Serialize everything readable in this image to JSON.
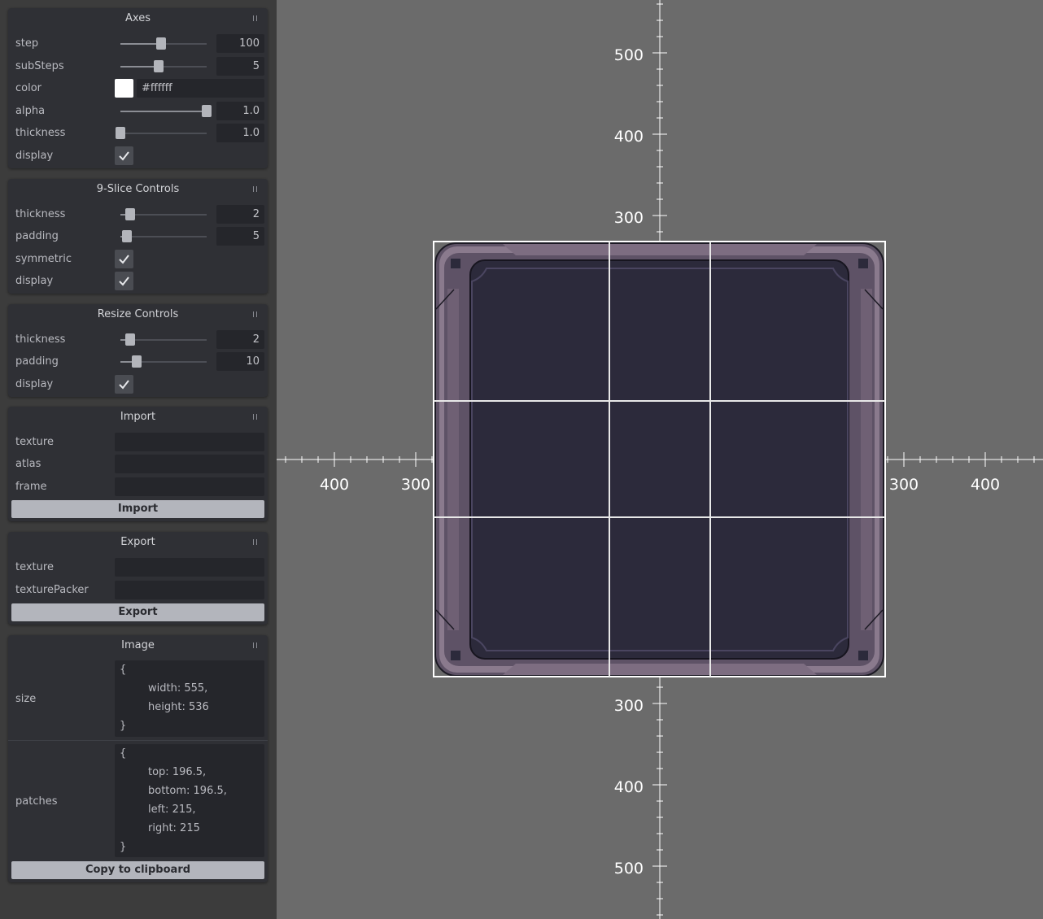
{
  "axes": {
    "title": "Axes",
    "step": {
      "label": "step",
      "value": "100",
      "fraction": 0.47
    },
    "substeps": {
      "label": "subSteps",
      "value": "5",
      "fraction": 0.44
    },
    "color": {
      "label": "color",
      "value": "#ffffff"
    },
    "alpha": {
      "label": "alpha",
      "value": "1.0",
      "fraction": 1.0
    },
    "thickness": {
      "label": "thickness",
      "value": "1.0",
      "fraction": 0.0
    },
    "display": {
      "label": "display",
      "checked": true
    }
  },
  "nine_slice": {
    "title": "9-Slice Controls",
    "thickness": {
      "label": "thickness",
      "value": "2",
      "fraction": 0.11
    },
    "padding": {
      "label": "padding",
      "value": "5",
      "fraction": 0.08
    },
    "symmetric": {
      "label": "symmetric",
      "checked": true
    },
    "display": {
      "label": "display",
      "checked": true
    }
  },
  "resize": {
    "title": "Resize Controls",
    "thickness": {
      "label": "thickness",
      "value": "2",
      "fraction": 0.11
    },
    "padding": {
      "label": "padding",
      "value": "10",
      "fraction": 0.19
    },
    "display": {
      "label": "display",
      "checked": true
    }
  },
  "import": {
    "title": "Import",
    "texture_label": "texture",
    "atlas_label": "atlas",
    "frame_label": "frame",
    "button": "Import"
  },
  "export": {
    "title": "Export",
    "texture_label": "texture",
    "texturepacker_label": "texturePacker",
    "button": "Export"
  },
  "image": {
    "title": "Image",
    "size_label": "size",
    "size_lines": [
      "{",
      "width: 555,",
      "height: 536",
      "}"
    ],
    "patches_label": "patches",
    "patches_lines": [
      "{",
      "top: 196.5,",
      "bottom: 196.5,",
      "left: 215,",
      "right: 215",
      "}"
    ],
    "copy_button": "Copy to clipboard"
  },
  "canvas": {
    "axis_labels": {
      "y_top_500": "500",
      "y_top_400": "400",
      "y_top_300": "300",
      "x_left_400": "400",
      "x_left_300": "300",
      "x_right_300": "300",
      "x_right_400": "400",
      "y_bottom_300": "300",
      "y_bottom_400": "400",
      "y_bottom_500": "500"
    },
    "colors": {
      "background": "#6b6b6b",
      "frame_outer": "#5e5266",
      "frame_rim": "#8a7a8d",
      "panel_fill": "#2c2a3b",
      "guide": "#ffffff"
    }
  }
}
